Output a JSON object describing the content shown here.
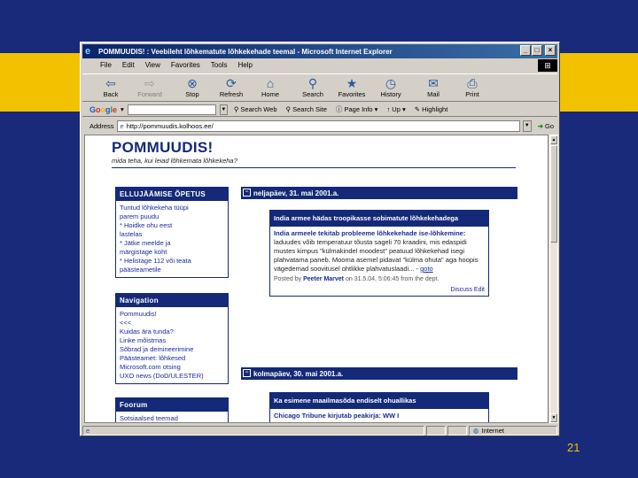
{
  "slide": {
    "number": "21"
  },
  "window": {
    "title": "POMMUUDIS! : Veebileht lõhkematute lõhkekehade teemal - Microsoft Internet Explorer",
    "buttons": {
      "minimize": "_",
      "maximize": "□",
      "close": "×"
    }
  },
  "menu": [
    "File",
    "Edit",
    "View",
    "Favorites",
    "Tools",
    "Help"
  ],
  "toolbar": [
    {
      "label": "Back",
      "icon": "back-arrow",
      "glyph": "⇦",
      "enabled": true
    },
    {
      "label": "Forward",
      "icon": "forward-arrow",
      "glyph": "⇨",
      "enabled": false
    },
    {
      "label": "Stop",
      "icon": "stop",
      "glyph": "⊗",
      "enabled": true
    },
    {
      "label": "Refresh",
      "icon": "refresh",
      "glyph": "⟳",
      "enabled": true
    },
    {
      "label": "Home",
      "icon": "home",
      "glyph": "⌂",
      "enabled": true
    },
    {
      "label": "Search",
      "icon": "search",
      "glyph": "⚲",
      "enabled": true
    },
    {
      "label": "Favorites",
      "icon": "favorites",
      "glyph": "★",
      "enabled": true
    },
    {
      "label": "History",
      "icon": "history",
      "glyph": "◷",
      "enabled": true
    },
    {
      "label": "Mail",
      "icon": "mail",
      "glyph": "✉",
      "enabled": true
    },
    {
      "label": "Print",
      "icon": "print",
      "glyph": "⎙",
      "enabled": true
    }
  ],
  "googlebar": {
    "logo": "Google",
    "search_web": "Search Web",
    "search_site": "Search Site",
    "page_info": "Page Info",
    "up": "Up",
    "highlight": "Highlight"
  },
  "address": {
    "label": "Address",
    "url": "http://pommuudis.kolhoos.ee/",
    "go": "Go"
  },
  "status": {
    "text": "",
    "zone": "Internet"
  },
  "site": {
    "title": "POMMUUDIS!",
    "subtitle": "mida teha, kui leiad lõhkemata lõhkekeha?"
  },
  "sidebar": {
    "survival": {
      "heading": "ELLUJÄÄMISE ÕPETUS",
      "lines": [
        "Tuntud lõhkekeha tüüpi",
        "parem puudu",
        "* Hoidke ohu eest",
        "lastelas",
        "* Jätke meelde ja",
        "märgistage koht",
        "* Helistage 112 või teata",
        "päästeametile"
      ]
    },
    "navigation": {
      "heading": "Navigation",
      "lines": [
        "Pommuudis!",
        "<<<",
        "Kuidas ära tunda?",
        "Linke mõistmas",
        "Sõbrad ja demineerimine",
        "Päästeamet: lõhkesed",
        "Microsoft.com otsing",
        "UXO news (DoD/ULESTER)"
      ]
    },
    "forum": {
      "heading": "Foorum",
      "lines": [
        "Sotsiaalsed teemad"
      ]
    }
  },
  "posts": [
    {
      "date": "neljapäev, 31. mai 2001.a.",
      "headline": "India armee hädas troopikasse sobimatute lõhkekehadega",
      "lead": "India armeele tekitab probleeme lõhkekehade ise-lõhkemine:",
      "body": "laduudes võib temperatuur tõusta sageli 70 kraadini, mis edaspidi mustes kimpus \"külmakindel moodest\" peatuud lõhkekehad isegi plahvatama paneb. Mooma asemel pidavat \"külma ohuta\" aga hoopis vägedemad soovitusel ohtlikke plahvatuslaadi... -",
      "link": "goto",
      "meta_prefix": "Posted by",
      "author": "Peeter Marvet",
      "meta_suffix": "on 31.5.04, 5:06:45 from the dept.",
      "footer": "Discuss Edit"
    },
    {
      "date": "kolmapäev, 30. mai 2001.a.",
      "headline": "Ka esimene maailmasõda endiselt ohuallikas",
      "lead": "Chicago Tribune kirjutab peakirja: WW I"
    }
  ]
}
